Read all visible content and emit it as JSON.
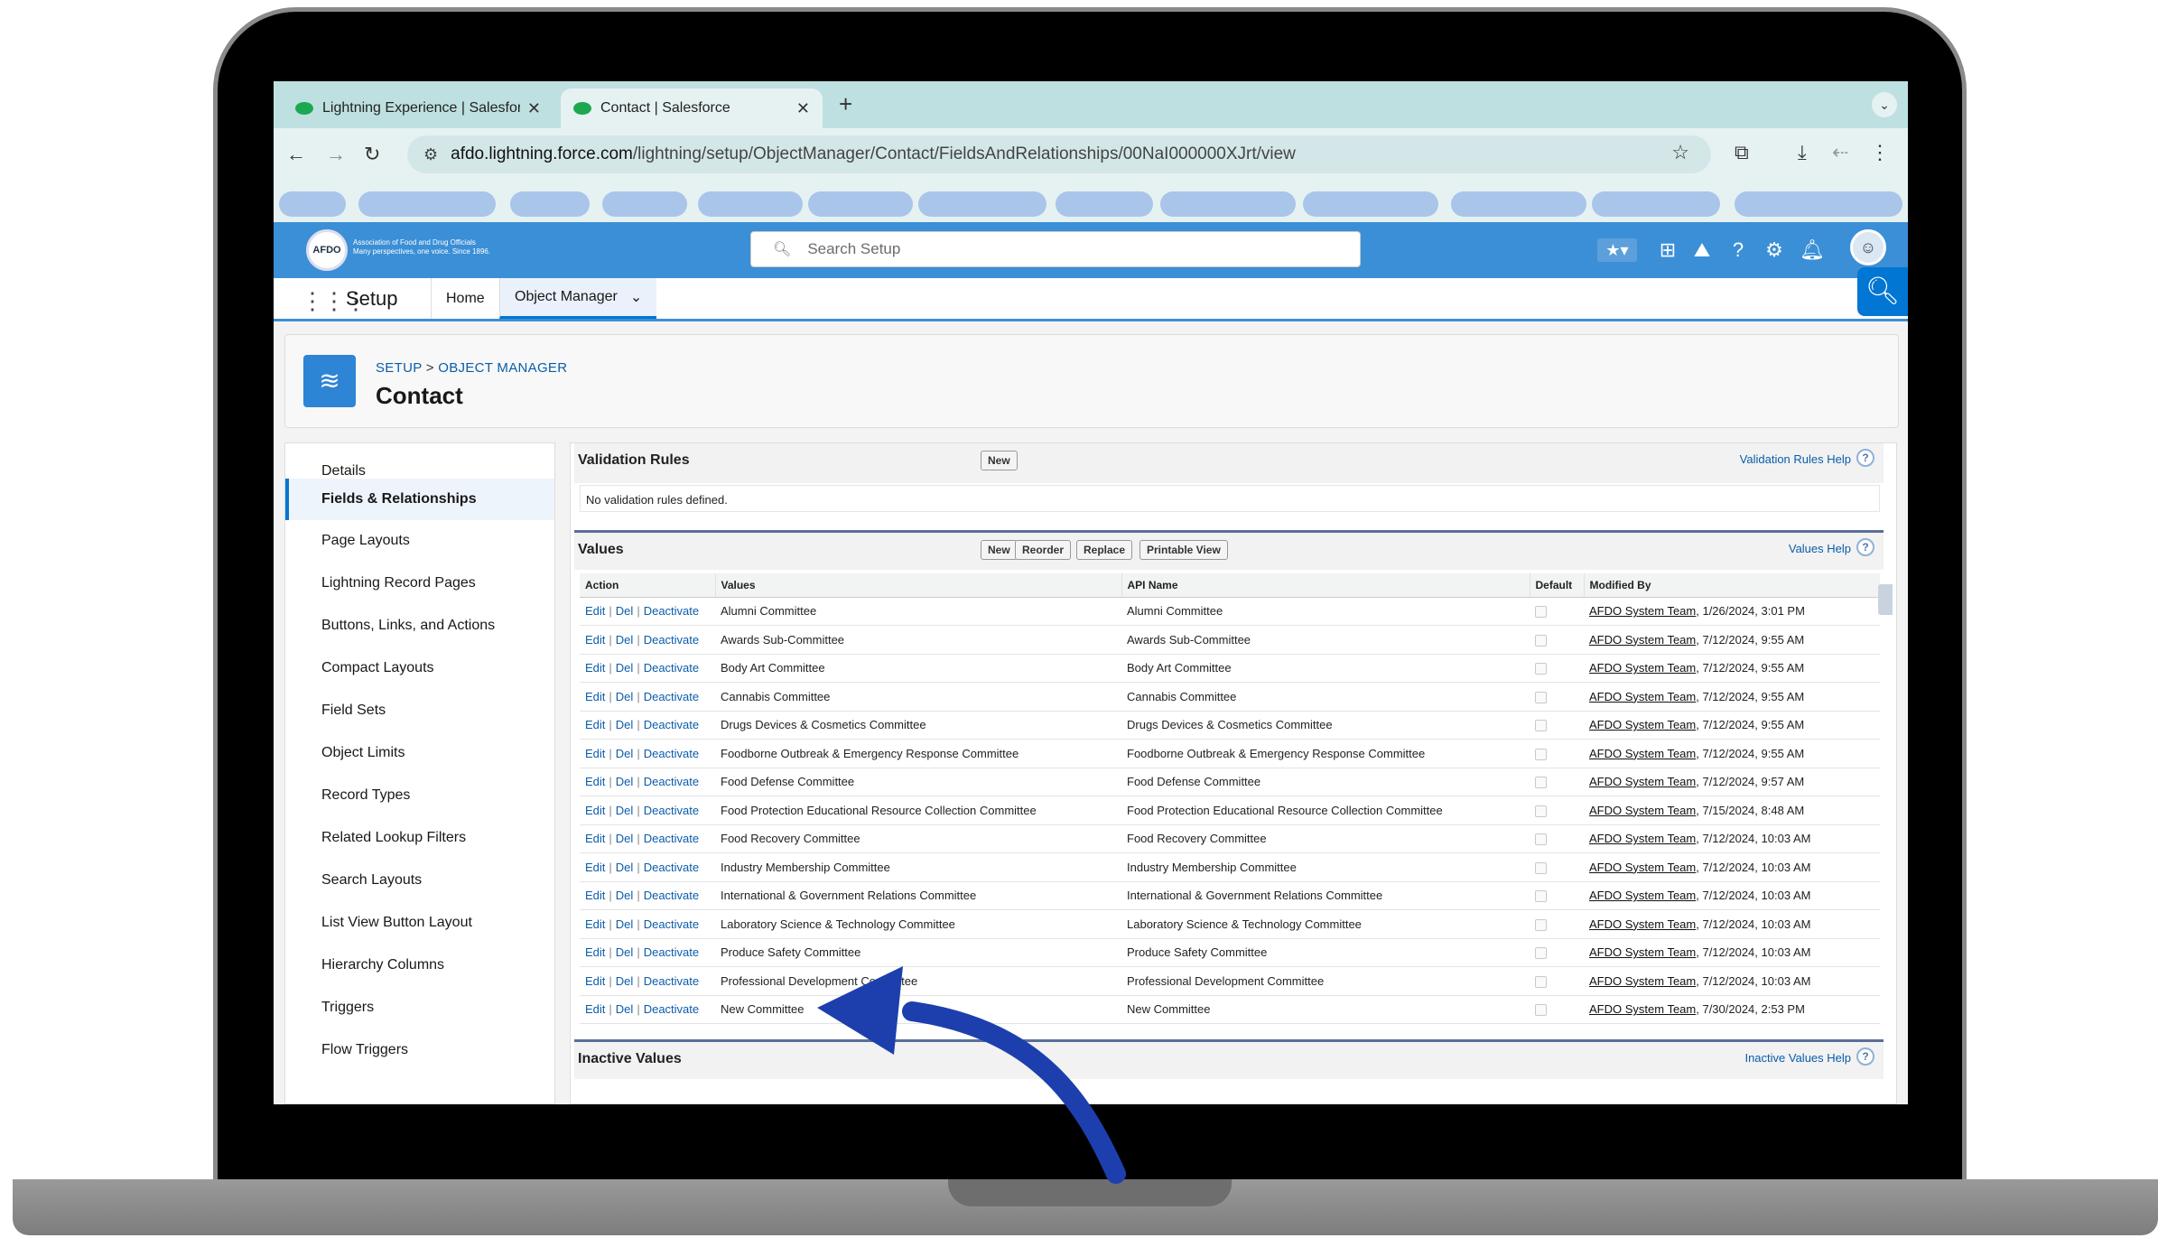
{
  "browser": {
    "tabs": [
      {
        "label": "Lightning Experience | Salesforce",
        "active": false
      },
      {
        "label": "Contact | Salesforce",
        "active": true
      }
    ],
    "new_tab": "+",
    "url_host": "afdo.lightning.force.com",
    "url_path": "/lightning/setup/ObjectManager/Contact/FieldsAndRelationships/00NaI000000XJrt/view"
  },
  "header": {
    "org_logo_text": "AFDO",
    "org_name": "Association of Food and Drug Officials",
    "org_tagline": "Many perspectives, one voice. Since 1896.",
    "search_placeholder": "Search Setup",
    "accent_color": "#3b8fd6"
  },
  "setup_nav": {
    "title": "Setup",
    "tabs": [
      {
        "label": "Home",
        "active": false
      },
      {
        "label": "Object Manager",
        "active": true
      }
    ]
  },
  "object_header": {
    "breadcrumb_setup": "SETUP",
    "breadcrumb_sep": ">",
    "breadcrumb_object_manager": "OBJECT MANAGER",
    "title": "Contact"
  },
  "sidebar": {
    "items": [
      {
        "label": "Details",
        "active": false
      },
      {
        "label": "Fields & Relationships",
        "active": true
      },
      {
        "label": "Page Layouts",
        "active": false
      },
      {
        "label": "Lightning Record Pages",
        "active": false
      },
      {
        "label": "Buttons, Links, and Actions",
        "active": false
      },
      {
        "label": "Compact Layouts",
        "active": false
      },
      {
        "label": "Field Sets",
        "active": false
      },
      {
        "label": "Object Limits",
        "active": false
      },
      {
        "label": "Record Types",
        "active": false
      },
      {
        "label": "Related Lookup Filters",
        "active": false
      },
      {
        "label": "Search Layouts",
        "active": false
      },
      {
        "label": "List View Button Layout",
        "active": false
      },
      {
        "label": "Hierarchy Columns",
        "active": false
      },
      {
        "label": "Triggers",
        "active": false
      },
      {
        "label": "Flow Triggers",
        "active": false
      }
    ]
  },
  "validation_rules": {
    "title": "Validation Rules",
    "new_button": "New",
    "help": "Validation Rules Help",
    "empty_message": "No validation rules defined."
  },
  "values_section": {
    "title": "Values",
    "buttons": {
      "new": "New",
      "reorder": "Reorder",
      "replace": "Replace",
      "printable": "Printable View"
    },
    "help": "Values Help",
    "columns": [
      "Action",
      "Values",
      "API Name",
      "Default",
      "Modified By"
    ],
    "action_links": {
      "edit": "Edit",
      "del": "Del",
      "deactivate": "Deactivate",
      "sep": "|"
    },
    "rows": [
      {
        "value": "Alumni Committee",
        "api": "Alumni Committee",
        "user": "AFDO System Team",
        "date": ", 1/26/2024, 3:01 PM"
      },
      {
        "value": "Awards Sub-Committee",
        "api": "Awards Sub-Committee",
        "user": "AFDO System Team",
        "date": ", 7/12/2024, 9:55 AM"
      },
      {
        "value": "Body Art Committee",
        "api": "Body Art Committee",
        "user": "AFDO System Team",
        "date": ", 7/12/2024, 9:55 AM"
      },
      {
        "value": "Cannabis Committee",
        "api": "Cannabis Committee",
        "user": "AFDO System Team",
        "date": ", 7/12/2024, 9:55 AM"
      },
      {
        "value": "Drugs Devices & Cosmetics Committee",
        "api": "Drugs Devices & Cosmetics Committee",
        "user": "AFDO System Team",
        "date": ", 7/12/2024, 9:55 AM"
      },
      {
        "value": "Foodborne Outbreak & Emergency Response Committee",
        "api": "Foodborne Outbreak & Emergency Response Committee",
        "user": "AFDO System Team",
        "date": ", 7/12/2024, 9:55 AM"
      },
      {
        "value": "Food Defense Committee",
        "api": "Food Defense Committee",
        "user": "AFDO System Team",
        "date": ", 7/12/2024, 9:57 AM"
      },
      {
        "value": "Food Protection Educational Resource Collection Committee",
        "api": "Food Protection Educational Resource Collection Committee",
        "user": "AFDO System Team",
        "date": ", 7/15/2024, 8:48 AM"
      },
      {
        "value": "Food Recovery Committee",
        "api": "Food Recovery Committee",
        "user": "AFDO System Team",
        "date": ", 7/12/2024, 10:03 AM"
      },
      {
        "value": "Industry Membership Committee",
        "api": "Industry Membership Committee",
        "user": "AFDO System Team",
        "date": ", 7/12/2024, 10:03 AM"
      },
      {
        "value": "International & Government Relations Committee",
        "api": "International & Government Relations Committee",
        "user": "AFDO System Team",
        "date": ", 7/12/2024, 10:03 AM"
      },
      {
        "value": "Laboratory Science & Technology Committee",
        "api": "Laboratory Science & Technology Committee",
        "user": "AFDO System Team",
        "date": ", 7/12/2024, 10:03 AM"
      },
      {
        "value": "Produce Safety Committee",
        "api": "Produce Safety Committee",
        "user": "AFDO System Team",
        "date": ", 7/12/2024, 10:03 AM"
      },
      {
        "value": "Professional Development Committee",
        "api": "Professional Development Committee",
        "user": "AFDO System Team",
        "date": ", 7/12/2024, 10:03 AM"
      },
      {
        "value": "New Committee",
        "api": "New Committee",
        "user": "AFDO System Team",
        "date": ", 7/30/2024, 2:53 PM"
      }
    ]
  },
  "inactive_values": {
    "title": "Inactive Values",
    "help": "Inactive Values Help"
  },
  "annotation": {
    "arrow_color": "#1d3fae"
  }
}
